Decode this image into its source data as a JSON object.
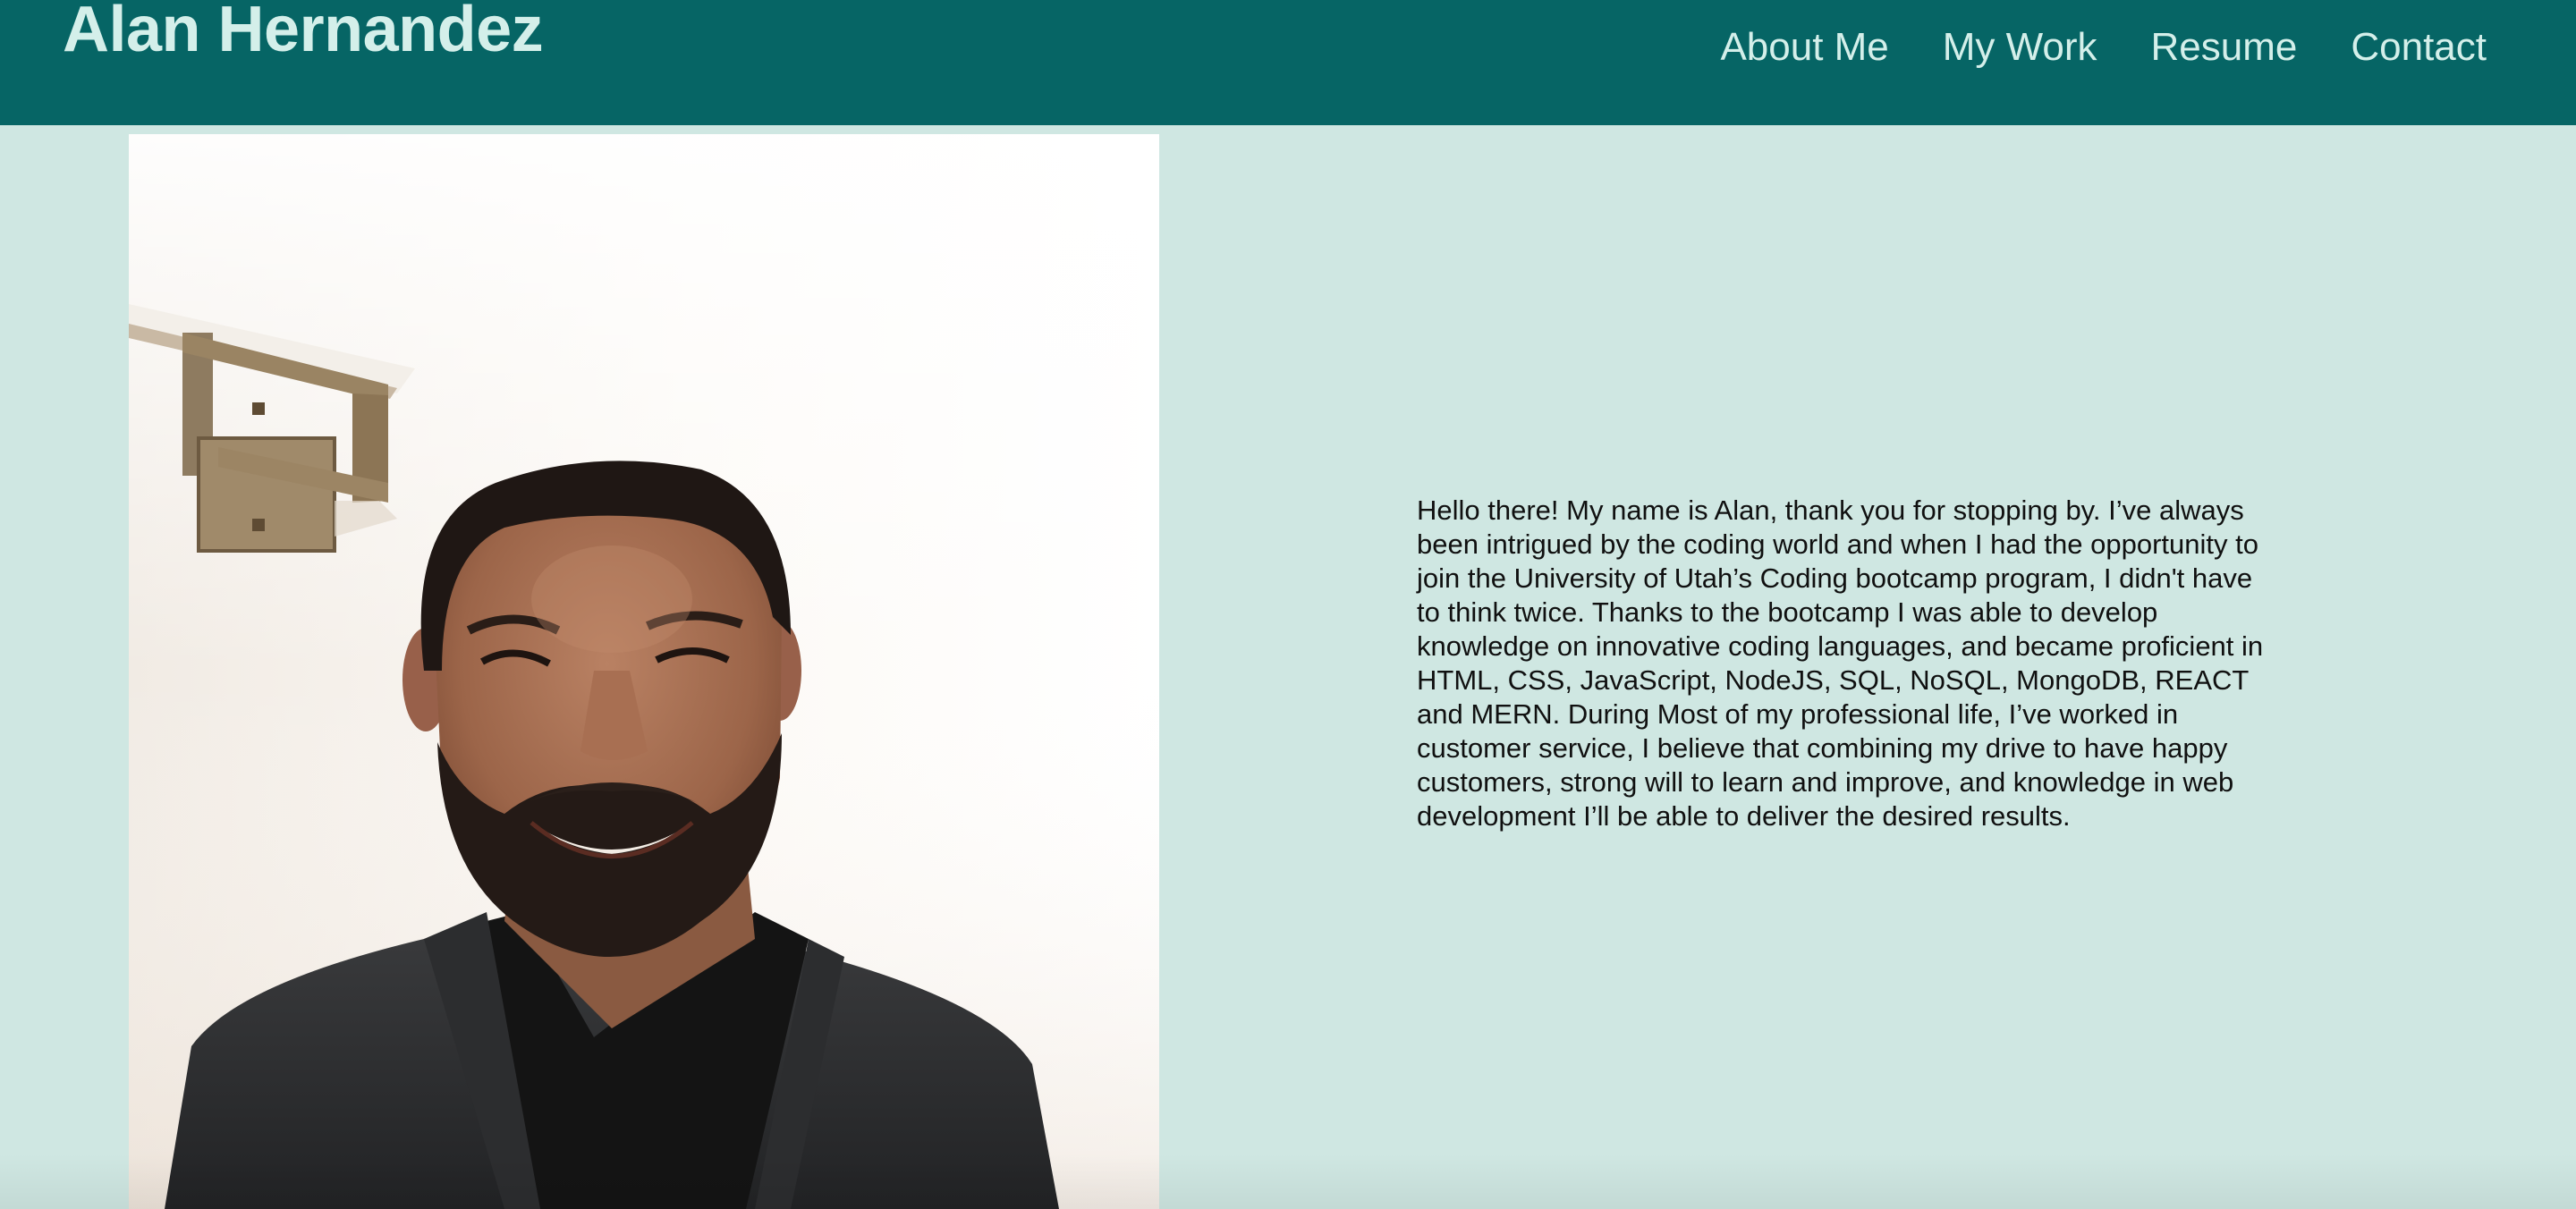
{
  "header": {
    "title": "Alan Hernandez",
    "nav": {
      "about": "About Me",
      "work": "My Work",
      "resume": "Resume",
      "contact": "Contact"
    }
  },
  "main": {
    "photo_alt": "Alan Hernandez",
    "bio": "Hello there! My name is Alan, thank you for stopping by. I’ve always been intrigued by the coding world and when I had the opportunity to join the University of Utah’s Coding bootcamp program, I didn't have to think twice. Thanks to the bootcamp I was able to develop knowledge on innovative coding languages, and became proficient in HTML, CSS, JavaScript, NodeJS, SQL, NoSQL, MongoDB, REACT and MERN. During Most of my professional life, I’ve worked in customer service, I believe that combining my drive to have happy customers, strong will to learn and improve, and knowledge in web development I’ll be able to deliver the desired results."
  },
  "colors": {
    "header_bg": "#066565",
    "header_text": "#d4efea",
    "page_bg": "#cfe7e2",
    "body_text": "#101010"
  }
}
